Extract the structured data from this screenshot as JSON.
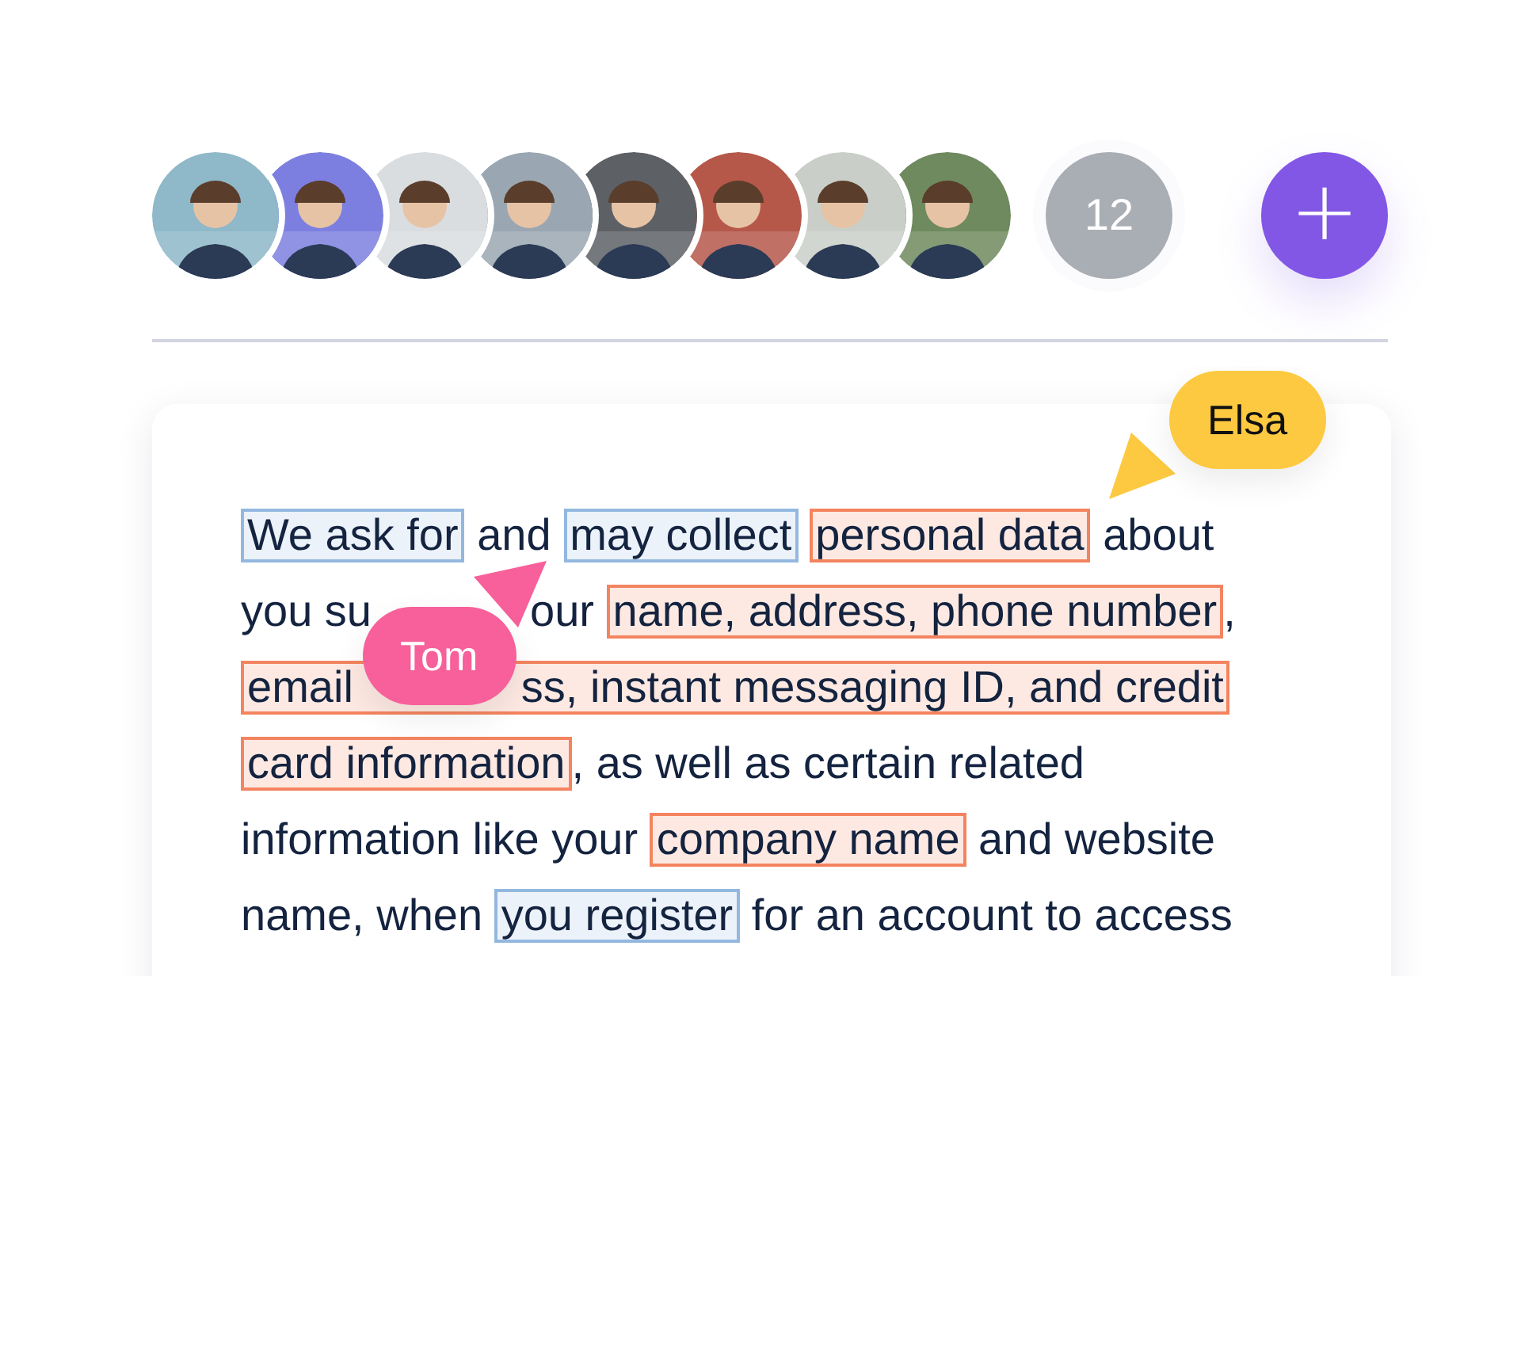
{
  "more_count": "12",
  "add_button": "+",
  "cursor": {
    "name": "Elsa",
    "color": "#fcc940"
  },
  "document": {
    "lines": [
      [
        {
          "kind": "highlight",
          "text": "We ask for",
          "color": "#93b8e0",
          "continues": false
        },
        {
          "kind": "plain",
          "text": " and "
        },
        {
          "kind": "highlight",
          "text": "may collect",
          "color": "#93b8e0",
          "continues": false
        },
        {
          "kind": "highlight",
          "text": "personal data",
          "color": "#f4845f",
          "continues": false
        },
        {
          "kind": "plain",
          "text": " about"
        }
      ],
      [
        {
          "kind": "plain",
          "text": "you su"
        },
        {
          "kind": "cursor",
          "name": "Tom",
          "color": "#f7609a"
        },
        {
          "kind": "plain",
          "text": "our "
        },
        {
          "kind": "highlight",
          "text": "name, address, phone number",
          "color": "#f4845f",
          "continues": false
        },
        {
          "kind": "plain",
          "text": ","
        }
      ],
      [
        {
          "kind": "highlight",
          "text": "email",
          "color": "#f4845f",
          "continues": true
        },
        {
          "kind": "highlight",
          "text": "ss, instant messaging ID, and credit",
          "color": "#f4845f",
          "continues": false
        }
      ],
      [
        {
          "kind": "highlight",
          "text": "card information",
          "color": "#f4845f",
          "continues": false
        },
        {
          "kind": "plain",
          "text": ", as well as certain related"
        }
      ],
      [
        {
          "kind": "plain",
          "text": "information like your "
        },
        {
          "kind": "highlight",
          "text": "company name",
          "color": "#f4845f",
          "continues": false
        },
        {
          "kind": "plain",
          "text": " and website"
        }
      ],
      [
        {
          "kind": "plain",
          "text": "name, when "
        },
        {
          "kind": "highlight",
          "text": "you register",
          "color": "#93b8e0",
          "continues": false
        },
        {
          "kind": "plain",
          "text": " for an account to access"
        }
      ]
    ]
  }
}
